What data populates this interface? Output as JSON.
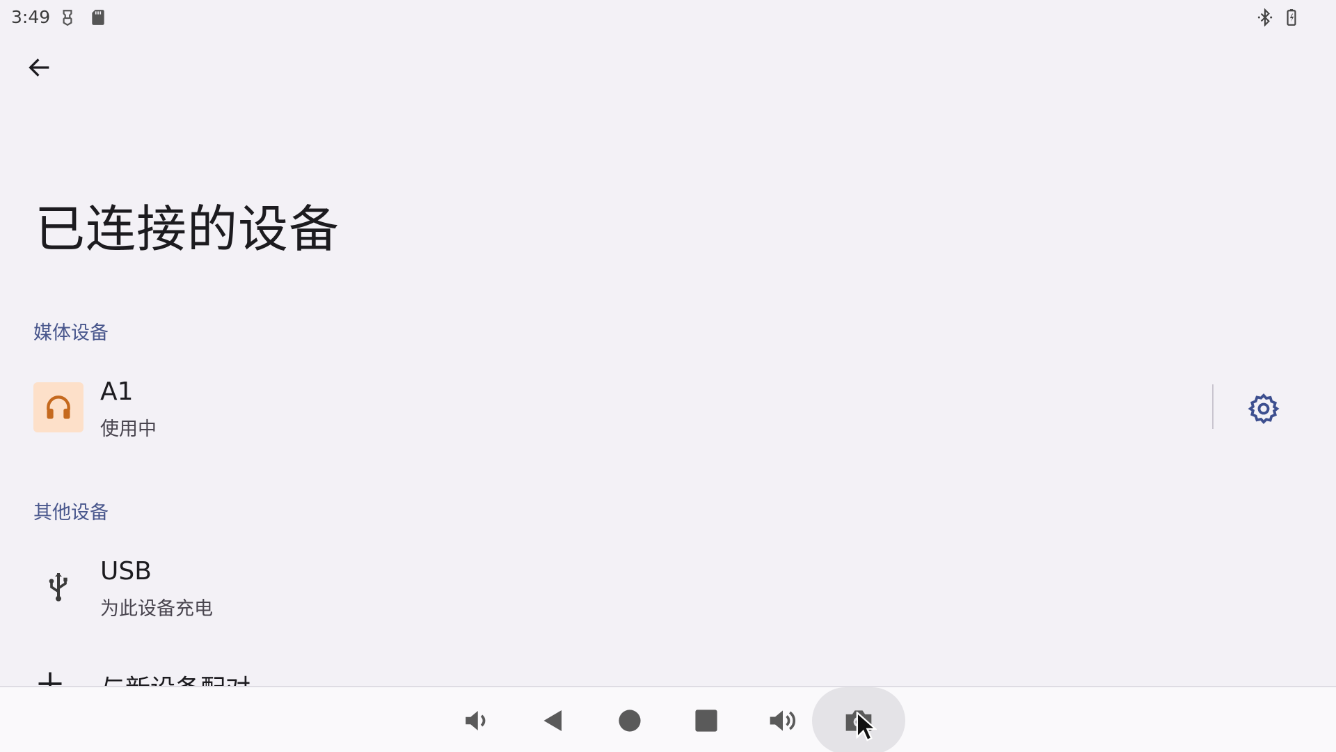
{
  "status_bar": {
    "time": "3:49",
    "left_icons": [
      "usb-debug-icon",
      "sd-card-icon"
    ],
    "right_icons": [
      "bluetooth-icon",
      "battery-charging-icon"
    ]
  },
  "app_bar": {
    "back_icon": "arrow-back-icon"
  },
  "page": {
    "title": "已连接的设备"
  },
  "sections": {
    "media": {
      "header": "媒体设备",
      "device": {
        "name": "A1",
        "status": "使用中",
        "icon": "headphones-icon",
        "icon_bg": "#fde0c9",
        "icon_color": "#c5691e",
        "action_icon": "gear-icon"
      }
    },
    "other": {
      "header": "其他设备",
      "device": {
        "name": "USB",
        "status": "为此设备充电",
        "icon": "usb-icon"
      }
    },
    "pair": {
      "label": "与新设备配对",
      "icon": "plus-icon"
    }
  },
  "nav_bar": {
    "buttons": [
      "volume-down-icon",
      "back-triangle-icon",
      "home-circle-icon",
      "recents-square-icon",
      "volume-up-icon",
      "screenshot-camera-icon"
    ],
    "active": "screenshot-camera-icon"
  },
  "colors": {
    "background": "#f3f1f6",
    "accent": "#48568c",
    "settings_icon": "#3d4f8f"
  }
}
